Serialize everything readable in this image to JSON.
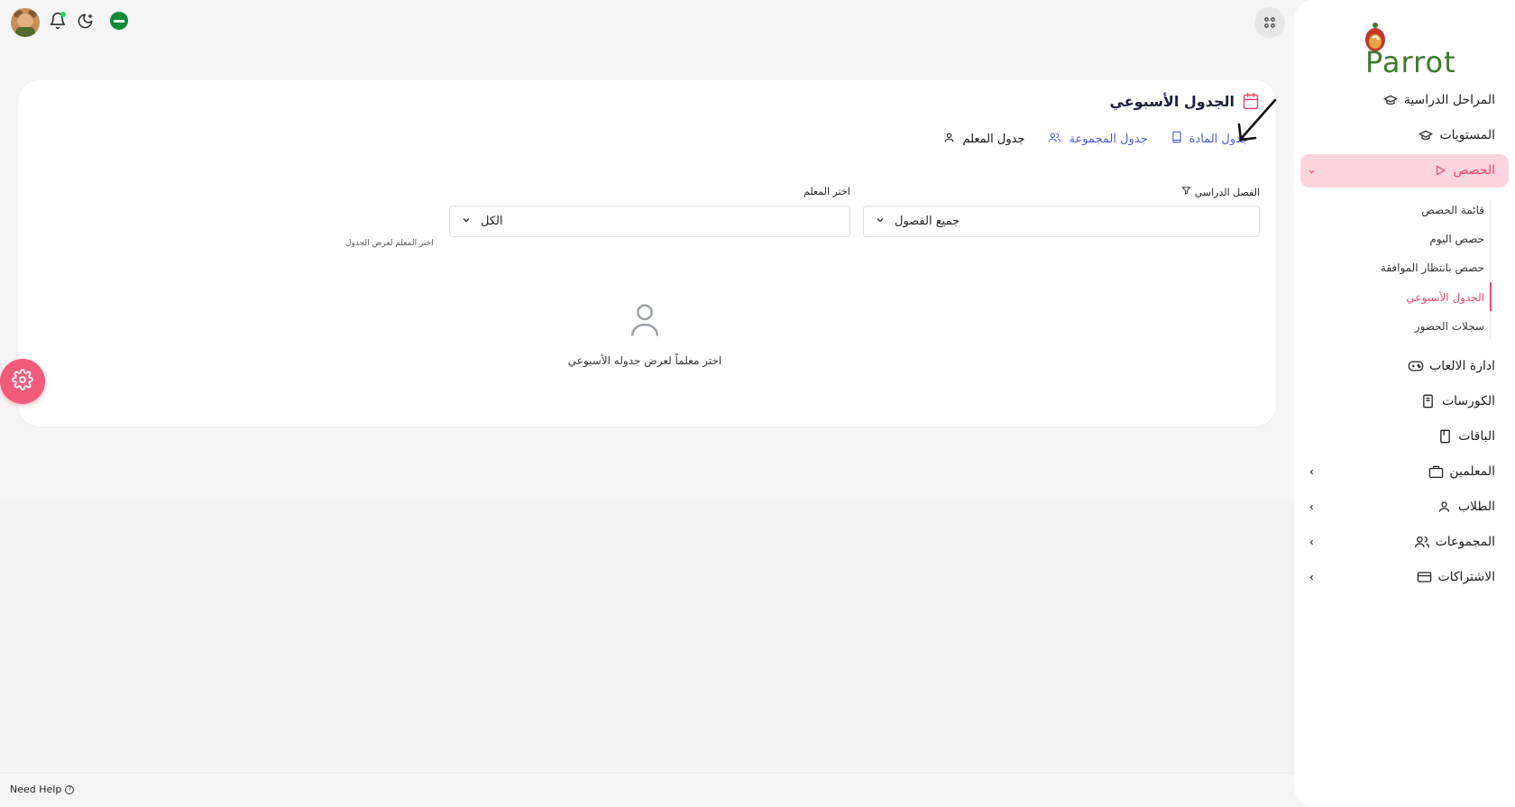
{
  "header": {
    "need_help": "Need Help"
  },
  "card": {
    "title": "الجدول الأسبوعي",
    "tabs": [
      {
        "label": "جدول المعلم",
        "icon": "user-icon",
        "active": true
      },
      {
        "label": "جدول المجموعة",
        "icon": "users-icon",
        "active": false
      },
      {
        "label": "جدول المادة",
        "icon": "book-icon",
        "active": false
      }
    ],
    "filters": {
      "semester_label": "الفصل الدراسي",
      "semester_value": "جميع الفصول",
      "teacher_label": "اختر المعلم",
      "teacher_value": "الكل",
      "teacher_hint": "اختر المعلم لعرض الجدول"
    },
    "empty_state": "اختر معلماً لعرض جدوله الأسبوعي"
  },
  "sidebar": {
    "logo": "Parrot",
    "items": [
      {
        "label": "المراحل الدراسية",
        "icon": "graduation-cap-icon"
      },
      {
        "label": "المستويات",
        "icon": "graduation-cap-icon"
      },
      {
        "label": "الحصص",
        "icon": "play-icon",
        "active": true
      },
      {
        "label": "ادارة الالعاب",
        "icon": "gamepad-icon"
      },
      {
        "label": "الكورسات",
        "icon": "book-icon"
      },
      {
        "label": "الباقات",
        "icon": "package-icon"
      },
      {
        "label": "المعلمين",
        "icon": "briefcase-icon"
      },
      {
        "label": "الطلاب",
        "icon": "user-icon"
      },
      {
        "label": "المجموعات",
        "icon": "users-icon"
      },
      {
        "label": "الاشتراكات",
        "icon": "card-icon"
      }
    ],
    "sub_items": [
      {
        "label": "قائمة الحصص"
      },
      {
        "label": "حصص اليوم"
      },
      {
        "label": "حصص بانتظار الموافقة"
      },
      {
        "label": "الجدول الأسبوعي",
        "active": true
      },
      {
        "label": "سجلات الحضور"
      }
    ]
  },
  "colors": {
    "accent": "#f0456b",
    "active_bg": "#fcd4de",
    "link": "#4f5bd5",
    "fab": "#f25c7c"
  }
}
